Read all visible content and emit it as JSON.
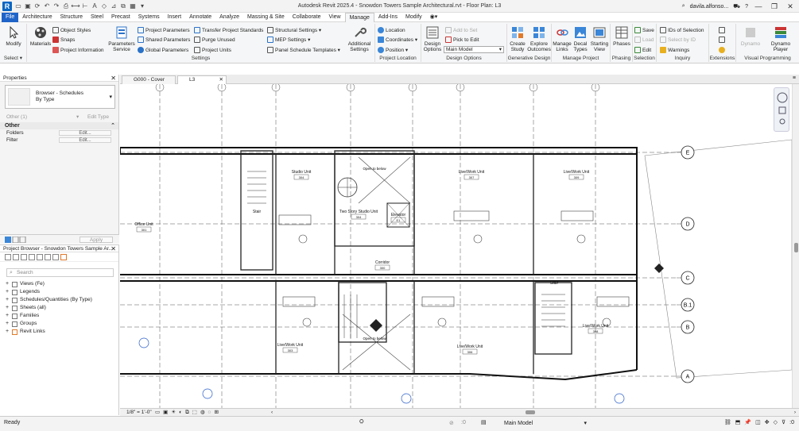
{
  "titlebar": {
    "logo": "R",
    "title": "Autodesk Revit 2025.4 - Snowdon Towers Sample Architectural.rvt - Floor Plan: L3",
    "user": "davila.alfonso...",
    "help": "?",
    "minimize": "—",
    "restore": "❐",
    "close": "✕"
  },
  "menu": {
    "tabs": [
      "File",
      "Architecture",
      "Structure",
      "Steel",
      "Precast",
      "Systems",
      "Insert",
      "Annotate",
      "Analyze",
      "Massing & Site",
      "Collaborate",
      "View",
      "Manage",
      "Add-Ins",
      "Modify"
    ],
    "active": "Manage"
  },
  "ribbon": {
    "select": {
      "modify": "Modify",
      "label": "Select ▾"
    },
    "settings": {
      "materials": "Materials",
      "object_styles": "Object  Styles",
      "snaps": "Snaps",
      "project_information": "Project  Information",
      "parameters_service": "Parameters Service",
      "project_parameters": "Project  Parameters",
      "shared_parameters": "Shared  Parameters",
      "global_parameters": "Global  Parameters",
      "transfer_project_standards": "Transfer  Project Standards",
      "purge_unused": "Purge  Unused",
      "project_units": "Project  Units",
      "structural_settings": "Structural  Settings ▾",
      "mep_settings": "MEP  Settings ▾",
      "panel_schedule_templates": "Panel Schedule  Templates ▾",
      "additional_settings": "Additional Settings",
      "label": "Settings"
    },
    "project_location": {
      "location": "Location",
      "coordinates": "Coordinates ▾",
      "position": "Position ▾",
      "label": "Project Location"
    },
    "design_options": {
      "design_options": "Design Options",
      "add_to_set": "Add to Set",
      "pick_to_edit": "Pick to Edit",
      "main_model": "Main Model",
      "label": "Design Options"
    },
    "generative_design": {
      "create_study": "Create Study",
      "explore_outcomes": "Explore Outcomes",
      "label": "Generative Design"
    },
    "manage_project": {
      "manage_links": "Manage Links",
      "decal_types": "Decal Types",
      "starting_view": "Starting View",
      "label": "Manage Project"
    },
    "phasing": {
      "phases": "Phases",
      "label": "Phasing"
    },
    "selection": {
      "save": "Save",
      "load": "Load",
      "edit": "Edit",
      "label": "Selection"
    },
    "inquiry": {
      "ids_of_selection": "IDs of Selection",
      "select_by_id": "Select by ID",
      "warnings": "Warnings",
      "label": "Inquiry"
    },
    "extensions": {
      "label": "Extensions"
    },
    "visual_programming": {
      "dynamo": "Dynamo",
      "dynamo_player": "Dynamo Player",
      "label": "Visual Programming"
    }
  },
  "properties": {
    "title": "Properties",
    "type_line1": "Browser - Schedules",
    "type_line2": "By Type",
    "filter": "Other (1)",
    "edit_type": "Edit Type",
    "section": "Other",
    "rows": [
      {
        "name": "Folders",
        "value": "Edit..."
      },
      {
        "name": "Filter",
        "value": "Edit..."
      }
    ],
    "apply": "Apply"
  },
  "browser": {
    "title": "Project Browser - Snowdon Towers Sample Ar...",
    "search_placeholder": "Search",
    "items": [
      "Views (Fe)",
      "Legends",
      "Schedules/Quantities (By Type)",
      "Sheets (all)",
      "Families",
      "Groups",
      "Revit Links"
    ]
  },
  "view_tabs": [
    {
      "label": "G000 - Cover"
    },
    {
      "label": "L3"
    }
  ],
  "plan": {
    "grid_labels": [
      "E",
      "D",
      "C",
      "B.1",
      "B",
      "A"
    ],
    "rooms": [
      {
        "name": "Studio Unit",
        "num": "304"
      },
      {
        "name": "Live/Work Unit",
        "num": "307"
      },
      {
        "name": "Live/Work Unit",
        "num": "309"
      },
      {
        "name": "Two Story Studio Unit",
        "num": "304"
      },
      {
        "name": "Elevator",
        "num": "E1"
      },
      {
        "name": "Stair",
        "num": ""
      },
      {
        "name": "Office Unit",
        "num": "301"
      },
      {
        "name": "Corridor",
        "num": "300"
      },
      {
        "name": "Live/Work Unit",
        "num": "303"
      },
      {
        "name": "Live/Work Unit",
        "num": "306"
      },
      {
        "name": "Live/Work Unit",
        "num": "308"
      },
      {
        "name": "Stair",
        "num": ""
      }
    ],
    "open_to_below": "Open to below"
  },
  "viewbar": {
    "scale": "1/8\" = 1'-0\""
  },
  "status": {
    "text": "Ready",
    "model": "Main Model",
    "filter_count": ":0",
    "workset": ":0"
  }
}
